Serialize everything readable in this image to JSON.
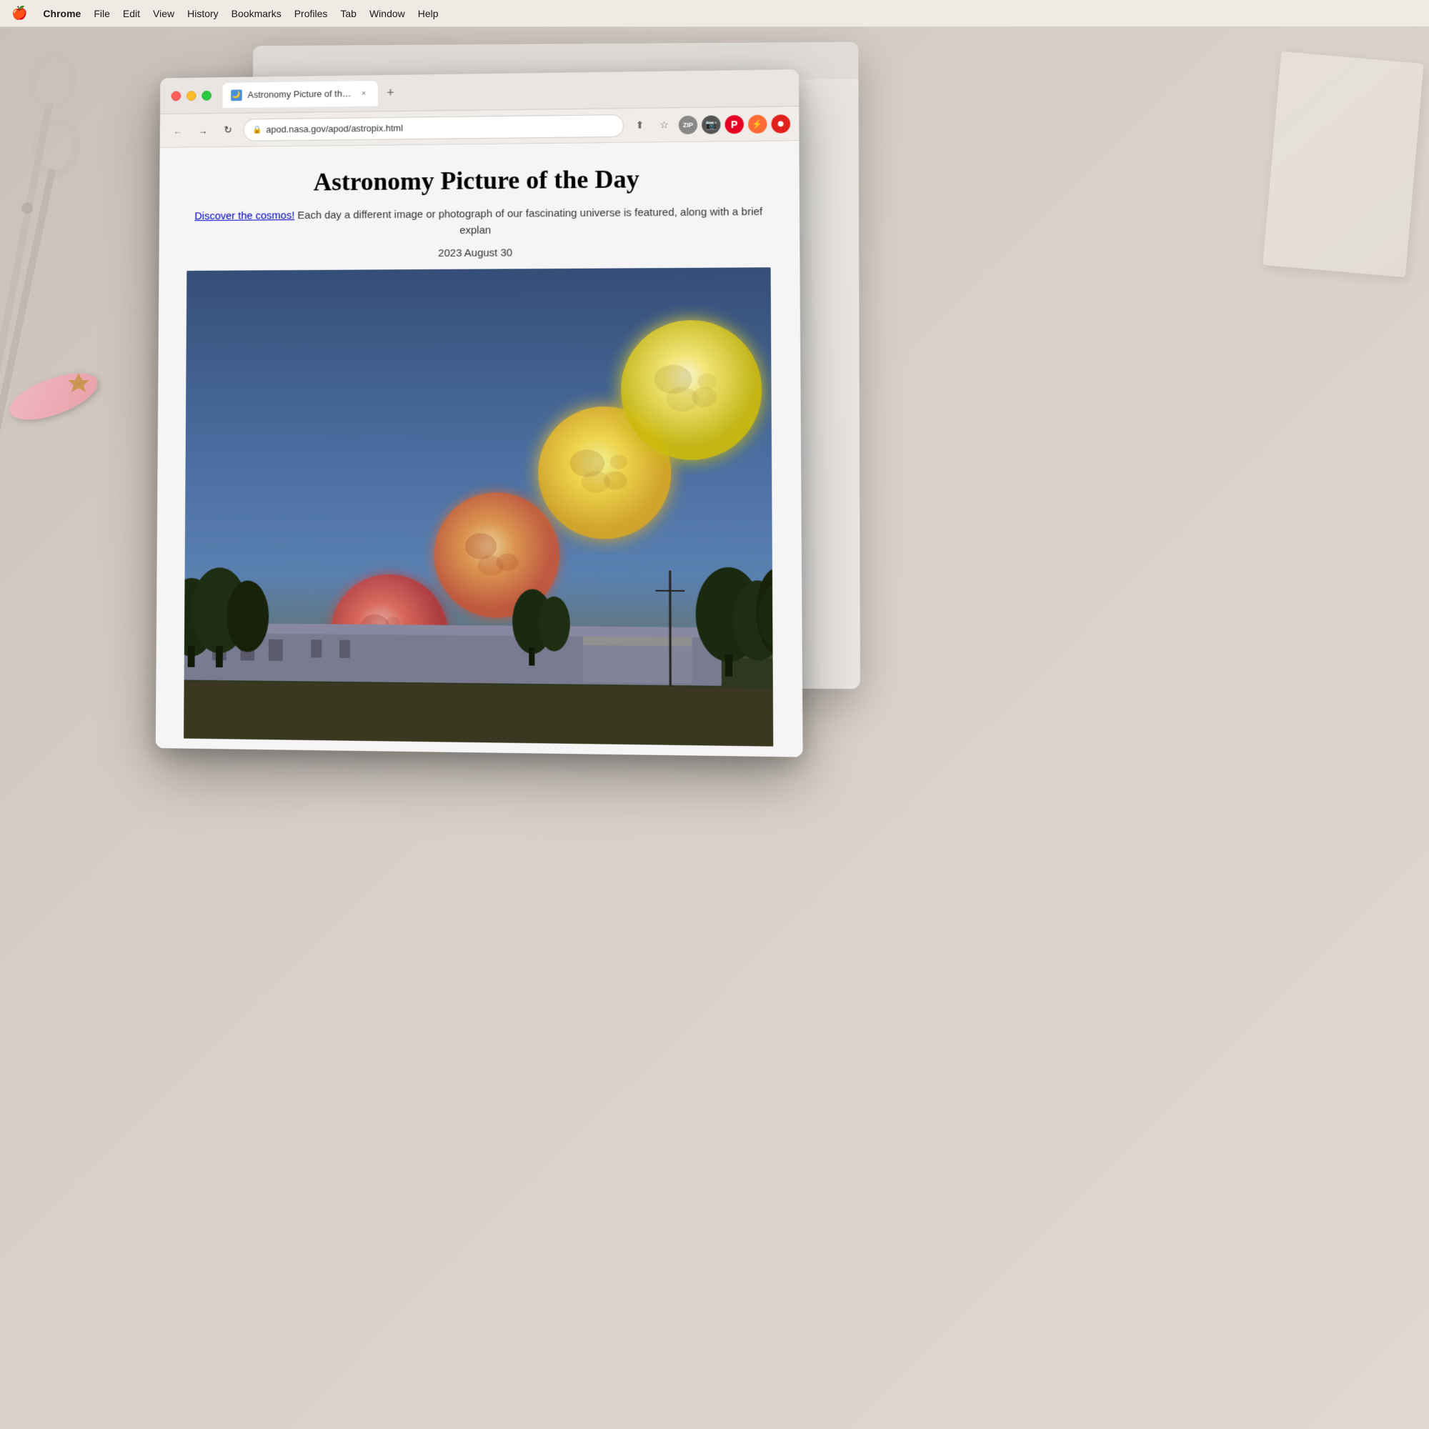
{
  "desktop": {
    "background_color": "#d8cfc8"
  },
  "menubar": {
    "apple_icon": "🍎",
    "items": [
      {
        "label": "Chrome",
        "bold": true
      },
      {
        "label": "File"
      },
      {
        "label": "Edit"
      },
      {
        "label": "View"
      },
      {
        "label": "History"
      },
      {
        "label": "Bookmarks"
      },
      {
        "label": "Profiles"
      },
      {
        "label": "Tab"
      },
      {
        "label": "Window"
      },
      {
        "label": "Help"
      }
    ]
  },
  "browser": {
    "tab": {
      "favicon_text": "🌙",
      "title": "Astronomy Picture of the Day",
      "close_icon": "×"
    },
    "new_tab_icon": "+",
    "nav": {
      "back_icon": "←",
      "forward_icon": "→",
      "reload_icon": "↻"
    },
    "address": {
      "lock_icon": "🔒",
      "url": "apod.nasa.gov/apod/astropix.html"
    },
    "toolbar_icons": {
      "share": "⬆",
      "bookmark": "☆",
      "zip_label": "ZIP",
      "camera_label": "📷",
      "pinterest_label": "P",
      "lightning_label": "⚡",
      "ext_red_label": "●"
    }
  },
  "webpage": {
    "title": "Astronomy Picture of the Day",
    "description_link": "Discover the cosmos!",
    "description_text": " Each day a different image or photograph of our fascinating universe is featured, along with a brief explan",
    "date": "2023 August 30",
    "image_alt": "Moon rising composite showing multiple phases of the moon rising over a stone building with trees"
  }
}
